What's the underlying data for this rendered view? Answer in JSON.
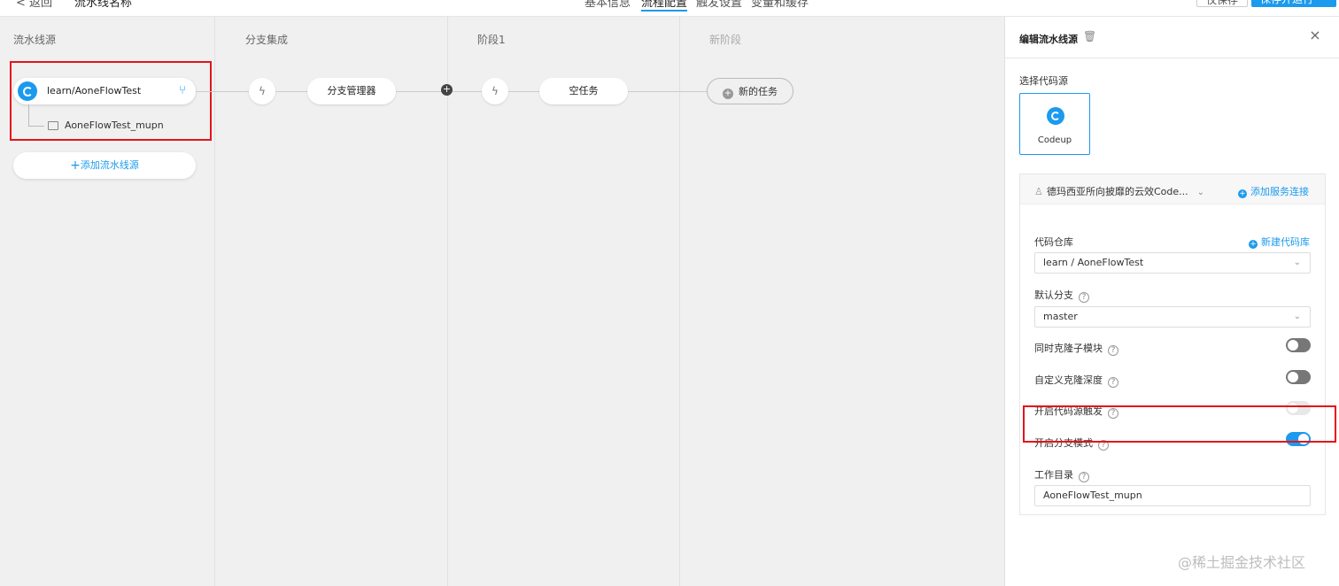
{
  "topbar": {
    "back_label": "< 返回",
    "pipeline_name": "流水线名称",
    "tabs": [
      "基本信息",
      "流程配置",
      "触发设置",
      "变量和缓存"
    ],
    "active_tab_index": 1,
    "buttons": {
      "secondary": "仅保存",
      "primary": "保存并运行"
    }
  },
  "canvas": {
    "columns": [
      {
        "title": "流水线源"
      },
      {
        "title": "分支集成"
      },
      {
        "title": "阶段1"
      },
      {
        "title": "新阶段"
      }
    ],
    "source": {
      "repo": "learn/AoneFlowTest",
      "workdir": "AoneFlowTest_mupn",
      "add_label": "添加流水线源"
    },
    "branch_stage": {
      "task_label": "分支管理器"
    },
    "stage1": {
      "task_label": "空任务"
    },
    "new_stage": {
      "task_label": "新的任务"
    }
  },
  "panel": {
    "title": "编辑流水线源",
    "source_type_label": "选择代码源",
    "source_type": "Codeup",
    "account": "德玛西亚所向披靡的云效Code...",
    "add_connection": "添加服务连接",
    "repo_label": "代码仓库",
    "new_repo": "新建代码库",
    "repo_value": "learn / AoneFlowTest",
    "branch_label": "默认分支",
    "branch_value": "master",
    "clone_submodules_label": "同时克隆子模块",
    "clone_submodules": false,
    "custom_depth_label": "自定义克隆深度",
    "custom_depth": false,
    "trigger_label": "开启代码源触发",
    "trigger": false,
    "branch_mode_label": "开启分支模式",
    "branch_mode": true,
    "workdir_label": "工作目录",
    "workdir_value": "AoneFlowTest_mupn"
  },
  "watermark": "@稀土掘金技术社区",
  "colors": {
    "accent": "#1b9aee",
    "highlight": "#e3141c"
  }
}
